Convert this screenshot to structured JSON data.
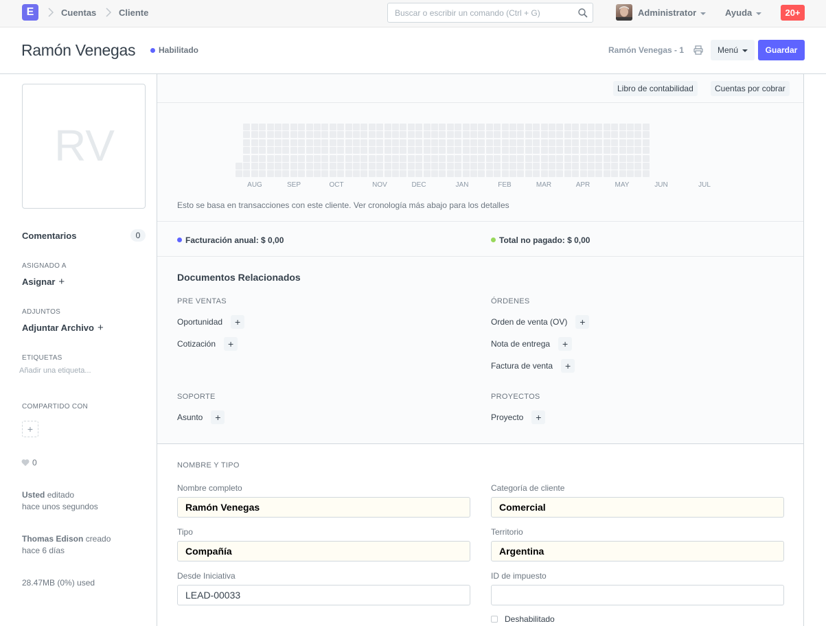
{
  "navbar": {
    "logo": "E",
    "breadcrumbs": [
      "Cuentas",
      "Cliente"
    ],
    "search_placeholder": "Buscar o escribir un comando (Ctrl + G)",
    "user": "Administrator",
    "help": "Ayuda",
    "notifications": "20+"
  },
  "header": {
    "title": "Ramón Venegas",
    "status": "Habilitado",
    "doc_name": "Ramón Venegas - 1",
    "menu_label": "Menú",
    "save_label": "Guardar"
  },
  "sidebar": {
    "initials": "RV",
    "comments_label": "Comentarios",
    "comments_count": "0",
    "assigned_heading": "ASIGNADO A",
    "assign_label": "Asignar",
    "attachments_heading": "ADJUNTOS",
    "attach_label": "Adjuntar Archivo",
    "tags_heading": "ETIQUETAS",
    "tags_placeholder": "Añadir una etiqueta...",
    "shared_heading": "COMPARTIDO CON",
    "likes": "0",
    "activity": [
      {
        "who": "Usted",
        "action": "editado",
        "when": "hace unos segundos"
      },
      {
        "who": "Thomas Edison",
        "action": "creado",
        "when": "hace 6 días"
      }
    ],
    "storage": "28.47MB (0%) used"
  },
  "dashboard": {
    "buttons": [
      "Libro de contabilidad",
      "Cuentas por cobrar"
    ],
    "months": [
      "AUG",
      "SEP",
      "OCT",
      "NOV",
      "DEC",
      "JAN",
      "FEB",
      "MAR",
      "APR",
      "MAY",
      "JUN",
      "JUL"
    ],
    "chart_note": "Esto se basa en transacciones con este cliente. Ver cronología más abajo para los detalles",
    "annual_billing": "Facturación anual: $ 0,00",
    "total_unpaid": "Total no pagado: $ 0,00",
    "colors": {
      "accent": "#5e64ff",
      "unpaid": "#98d85b",
      "heat_cell": "#ebedf0"
    }
  },
  "related_docs": {
    "title": "Documentos Relacionados",
    "groups": [
      {
        "label": "PRE VENTAS",
        "items": [
          "Oportunidad",
          "Cotización"
        ]
      },
      {
        "label": "ÓRDENES",
        "items": [
          "Orden de venta (OV)",
          "Nota de entrega",
          "Factura de venta"
        ]
      },
      {
        "label": "SOPORTE",
        "items": [
          "Asunto"
        ]
      },
      {
        "label": "PROYECTOS",
        "items": [
          "Proyecto"
        ]
      }
    ]
  },
  "form": {
    "section": "NOMBRE Y TIPO",
    "fields": {
      "full_name": {
        "label": "Nombre completo",
        "value": "Ramón Venegas"
      },
      "customer_group": {
        "label": "Categoría de cliente",
        "value": "Comercial"
      },
      "type": {
        "label": "Tipo",
        "value": "Compañía"
      },
      "territory": {
        "label": "Territorio",
        "value": "Argentina"
      },
      "lead": {
        "label": "Desde Iniciativa",
        "value": "LEAD-00033"
      },
      "tax_id": {
        "label": "ID de impuesto",
        "value": ""
      }
    },
    "disabled_label": "Deshabilitado"
  }
}
